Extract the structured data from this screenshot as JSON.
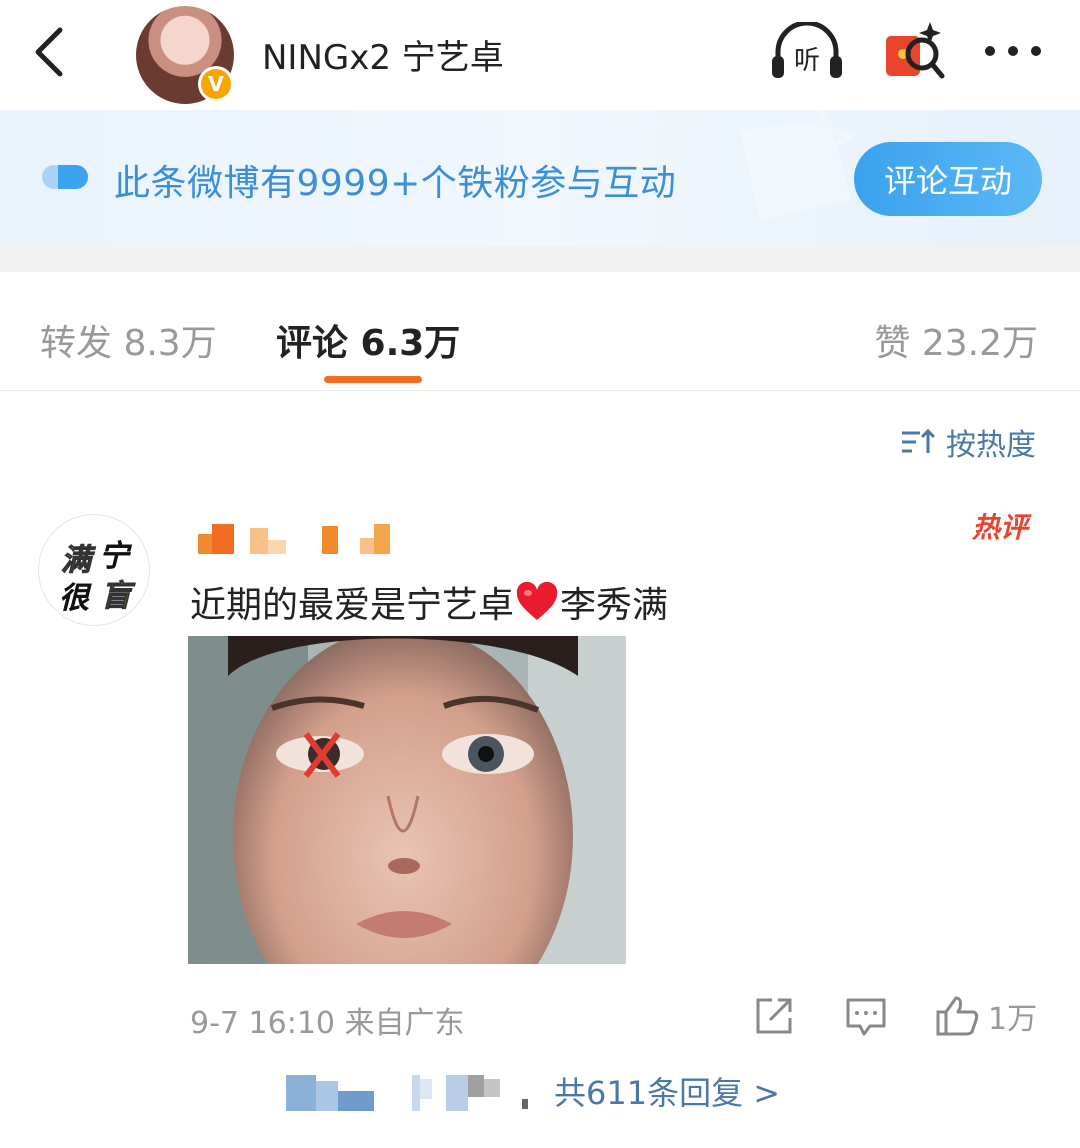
{
  "header": {
    "title": "NINGx2 宁艺卓",
    "verified_badge": "V",
    "icons": [
      "back-arrow-icon",
      "listen-icon",
      "red-packet-search-icon",
      "more-icon"
    ],
    "listen_label": "听"
  },
  "banner": {
    "text": "此条微博有9999+个铁粉参与互动",
    "button_label": "评论互动"
  },
  "tabs": {
    "repost": "转发 8.3万",
    "comment": "评论 6.3万",
    "like": "赞 23.2万",
    "active": "comment",
    "accent_color": "#f26d22"
  },
  "sort": {
    "label": "按热度"
  },
  "comment": {
    "avatar_chars": [
      "满",
      "宁",
      "很",
      "盲"
    ],
    "hot_badge": "热评",
    "text_before": "近期的最爱是宁艺卓",
    "text_after": "李秀满",
    "time_location": "9-7 16:10 来自广东",
    "like_count": "1万",
    "reply_link": "共611条回复 >"
  },
  "colors": {
    "link": "#4a79a8",
    "banner_text": "#3b8fd9",
    "hot": "#e8452c"
  }
}
